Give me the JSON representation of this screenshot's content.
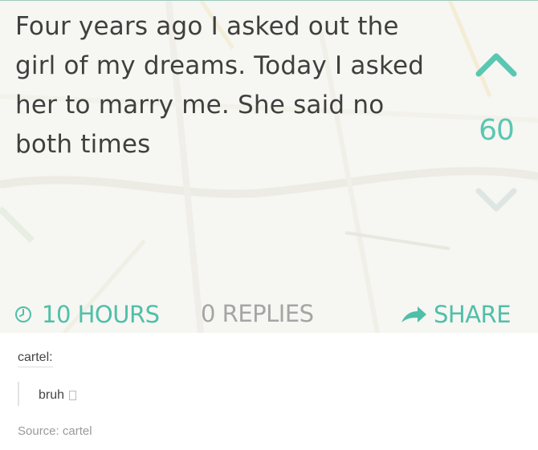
{
  "post": {
    "text_lines": [
      "Four years ago I asked out the",
      "girl of my dreams. Today I asked",
      "her to marry me. She said no",
      "both times"
    ],
    "vote_count": "60",
    "time": "10 HOURS",
    "replies": "0 REPLIES",
    "share": "SHARE",
    "icons": {
      "upvote": "chevron-up-icon",
      "downvote": "chevron-down-icon",
      "time": "clock-icon",
      "share": "share-arrow-icon"
    },
    "colors": {
      "accent": "#5ac7b1",
      "text": "#3f3f3f",
      "muted": "#a5a5a5",
      "downvote": "#dde6e2"
    }
  },
  "reblog": {
    "author": "cartel:",
    "comment": "bruh",
    "source": "Source: cartel"
  }
}
